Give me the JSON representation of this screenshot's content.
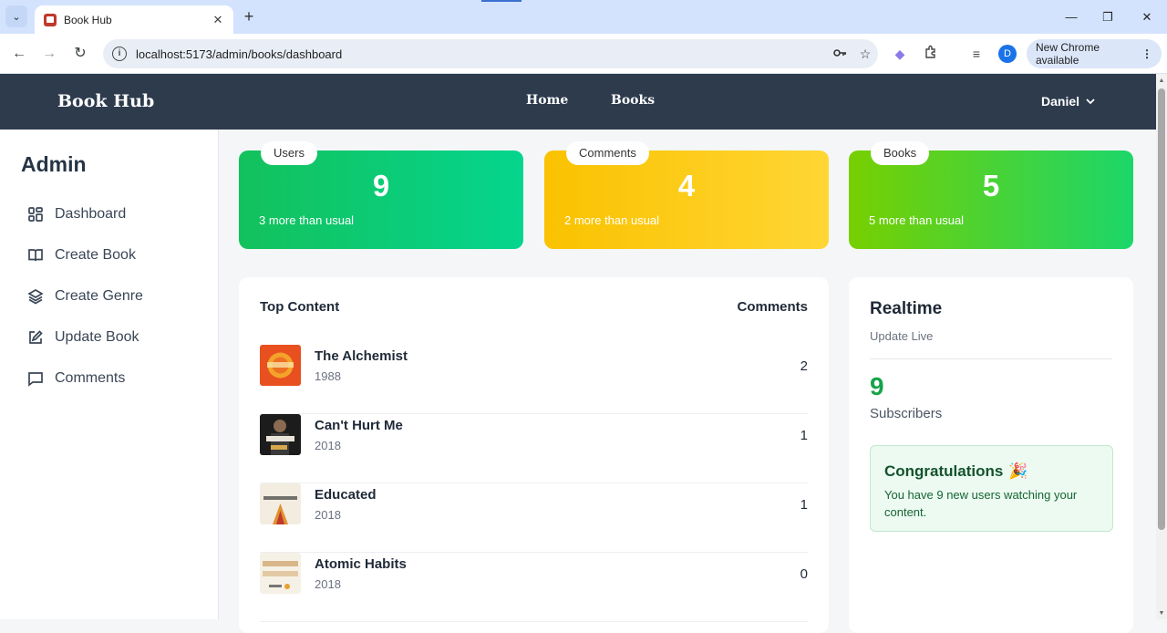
{
  "browser": {
    "tab_title": "Book Hub",
    "url": "localhost:5173/admin/books/dashboard",
    "profile_initial": "D",
    "update_label": "New Chrome available",
    "icons": [
      "back-icon",
      "forward-icon",
      "reload-icon",
      "info-icon",
      "key-icon",
      "star-icon",
      "extensions-icon",
      "media-icon",
      "menu-icon"
    ]
  },
  "navbar": {
    "brand": "Book Hub",
    "links": [
      "Home",
      "Books"
    ],
    "user": "Daniel"
  },
  "sidebar": {
    "title": "Admin",
    "items": [
      {
        "label": "Dashboard",
        "icon": "dashboard-icon"
      },
      {
        "label": "Create Book",
        "icon": "book-open-icon"
      },
      {
        "label": "Create Genre",
        "icon": "layers-icon"
      },
      {
        "label": "Update Book",
        "icon": "edit-icon"
      },
      {
        "label": "Comments",
        "icon": "comment-icon"
      }
    ]
  },
  "stats": [
    {
      "label": "Users",
      "value": "9",
      "sub": "3 more than usual",
      "color": "#13c15c"
    },
    {
      "label": "Comments",
      "value": "4",
      "sub": "2 more than usual",
      "color": "#fac200"
    },
    {
      "label": "Books",
      "value": "5",
      "sub": "5 more than usual",
      "color": "#77cf00"
    }
  ],
  "top_content": {
    "title": "Top Content",
    "column": "Comments",
    "books": [
      {
        "title": "The Alchemist",
        "year": "1988",
        "comments": "2"
      },
      {
        "title": "Can't Hurt Me",
        "year": "2018",
        "comments": "1"
      },
      {
        "title": "Educated",
        "year": "2018",
        "comments": "1"
      },
      {
        "title": "Atomic Habits",
        "year": "2018",
        "comments": "0"
      }
    ]
  },
  "realtime": {
    "title": "Realtime",
    "subtitle": "Update Live",
    "value": "9",
    "label": "Subscribers",
    "congrats_title": "Congratulations",
    "congrats_emoji": "🎉",
    "congrats_text": "You have 9 new users watching your content."
  }
}
